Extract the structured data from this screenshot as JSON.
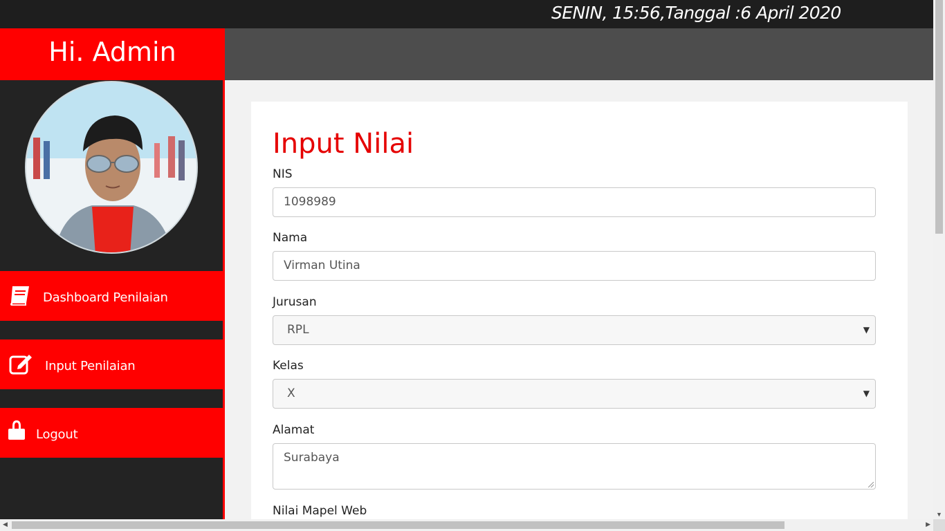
{
  "topbar": {
    "datetime": "SENIN, 15:56,Tanggal :6 April 2020"
  },
  "sidebar": {
    "greeting": "Hi. Admin",
    "nav": [
      {
        "label": "Dashboard Penilaian",
        "icon": "book-icon"
      },
      {
        "label": "Input Penilaian",
        "icon": "edit-icon"
      },
      {
        "label": "Logout",
        "icon": "lock-icon"
      }
    ]
  },
  "form": {
    "title": "Input Nilai",
    "nis": {
      "label": "NIS",
      "value": "1098989"
    },
    "nama": {
      "label": "Nama",
      "value": "Virman Utina"
    },
    "jurusan": {
      "label": "Jurusan",
      "selected": "RPL"
    },
    "kelas": {
      "label": "Kelas",
      "selected": "X"
    },
    "alamat": {
      "label": "Alamat",
      "value": "Surabaya"
    },
    "nilai_web": {
      "label": "Nilai Mapel Web"
    }
  },
  "colors": {
    "accent": "#ff0000",
    "title": "#e50000",
    "topbar": "#1e1e1e",
    "header": "#4d4d4d"
  }
}
